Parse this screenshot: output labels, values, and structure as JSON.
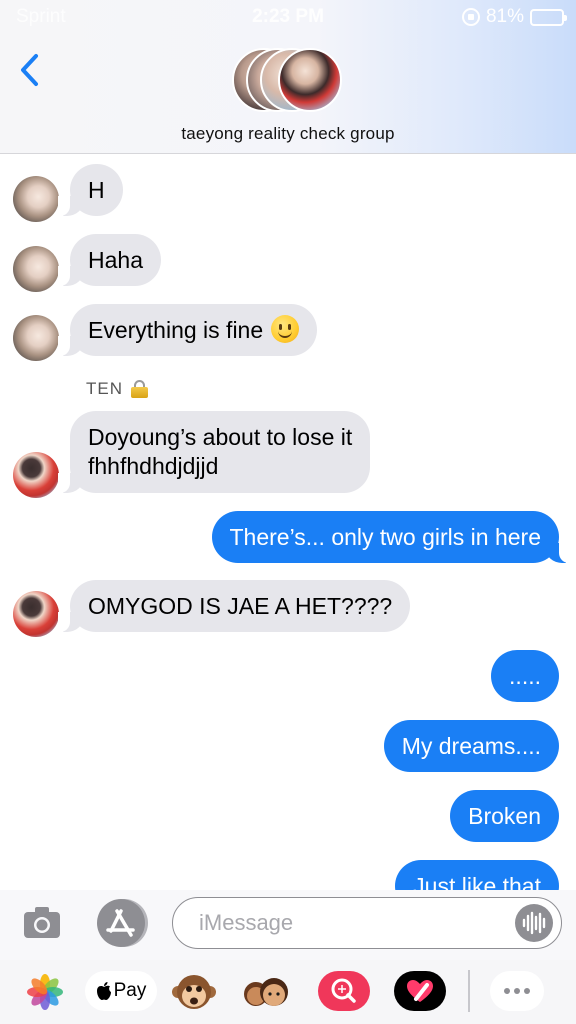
{
  "status_bar": {
    "carrier": "Sprint",
    "time": "2:23 PM",
    "battery": "81%",
    "battery_level": 0.81
  },
  "header": {
    "group_name": "taeyong reality check group"
  },
  "messages": [
    {
      "from": "received",
      "sender": "taeyong",
      "text": "H"
    },
    {
      "from": "received",
      "sender": "taeyong",
      "text": "Haha"
    },
    {
      "from": "received",
      "sender": "taeyong",
      "text": "Everything is fine",
      "emoji": "slightly-smiling-face"
    },
    {
      "from": "received",
      "sender_label": "TEN",
      "sender_emoji": "lock",
      "text_line1": "Doyoung’s about to lose it",
      "text_line2": "fhhfhdhdjdjjd"
    },
    {
      "from": "sent",
      "text": "There’s... only two girls in here"
    },
    {
      "from": "received",
      "sender": "ten",
      "text": "OMYGOD IS JAE A HET????"
    },
    {
      "from": "sent",
      "text": "....."
    },
    {
      "from": "sent",
      "text": "My dreams...."
    },
    {
      "from": "sent",
      "text": "Broken"
    },
    {
      "from": "sent",
      "text": "Just like that"
    }
  ],
  "input": {
    "placeholder": "iMessage",
    "value": ""
  },
  "app_drawer": {
    "apple_pay_label": "Pay",
    "items": [
      "photos-icon",
      "apple-pay-icon",
      "animoji-icon",
      "memoji-icon",
      "images-search-icon",
      "digital-touch-icon",
      "more-icon"
    ]
  },
  "colors": {
    "sent_bubble": "#1a7ff5",
    "received_bubble": "#e6e6eb",
    "accent": "#1a7ff5"
  }
}
